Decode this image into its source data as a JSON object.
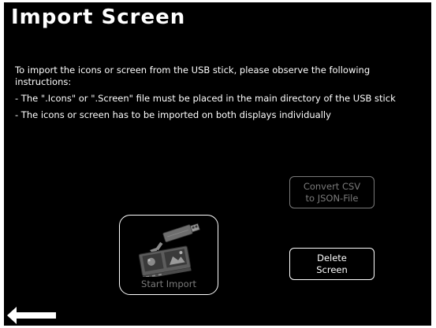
{
  "page": {
    "title": "Import Screen"
  },
  "instructions": {
    "line1": "To import the icons or screen from the USB stick, please observe the following instructions:",
    "line2": "- The \".Icons\" or \".Screen\" file must be placed in the main directory of the USB stick",
    "line3": "- The icons or screen has to be imported on both displays individually"
  },
  "buttons": {
    "convert_label_line1": "Convert CSV",
    "convert_label_line2": "to JSON-File",
    "convert_enabled": false,
    "delete_label_line1": "Delete",
    "delete_label_line2": "Screen",
    "start_import_label": "Start Import",
    "start_import_icon": "usb-stick-import-icon",
    "start_import_enabled": false
  },
  "nav": {
    "back_icon": "arrow-left-icon"
  },
  "colors": {
    "background": "#000000",
    "text": "#ffffff",
    "disabled": "#7a7a7a"
  }
}
